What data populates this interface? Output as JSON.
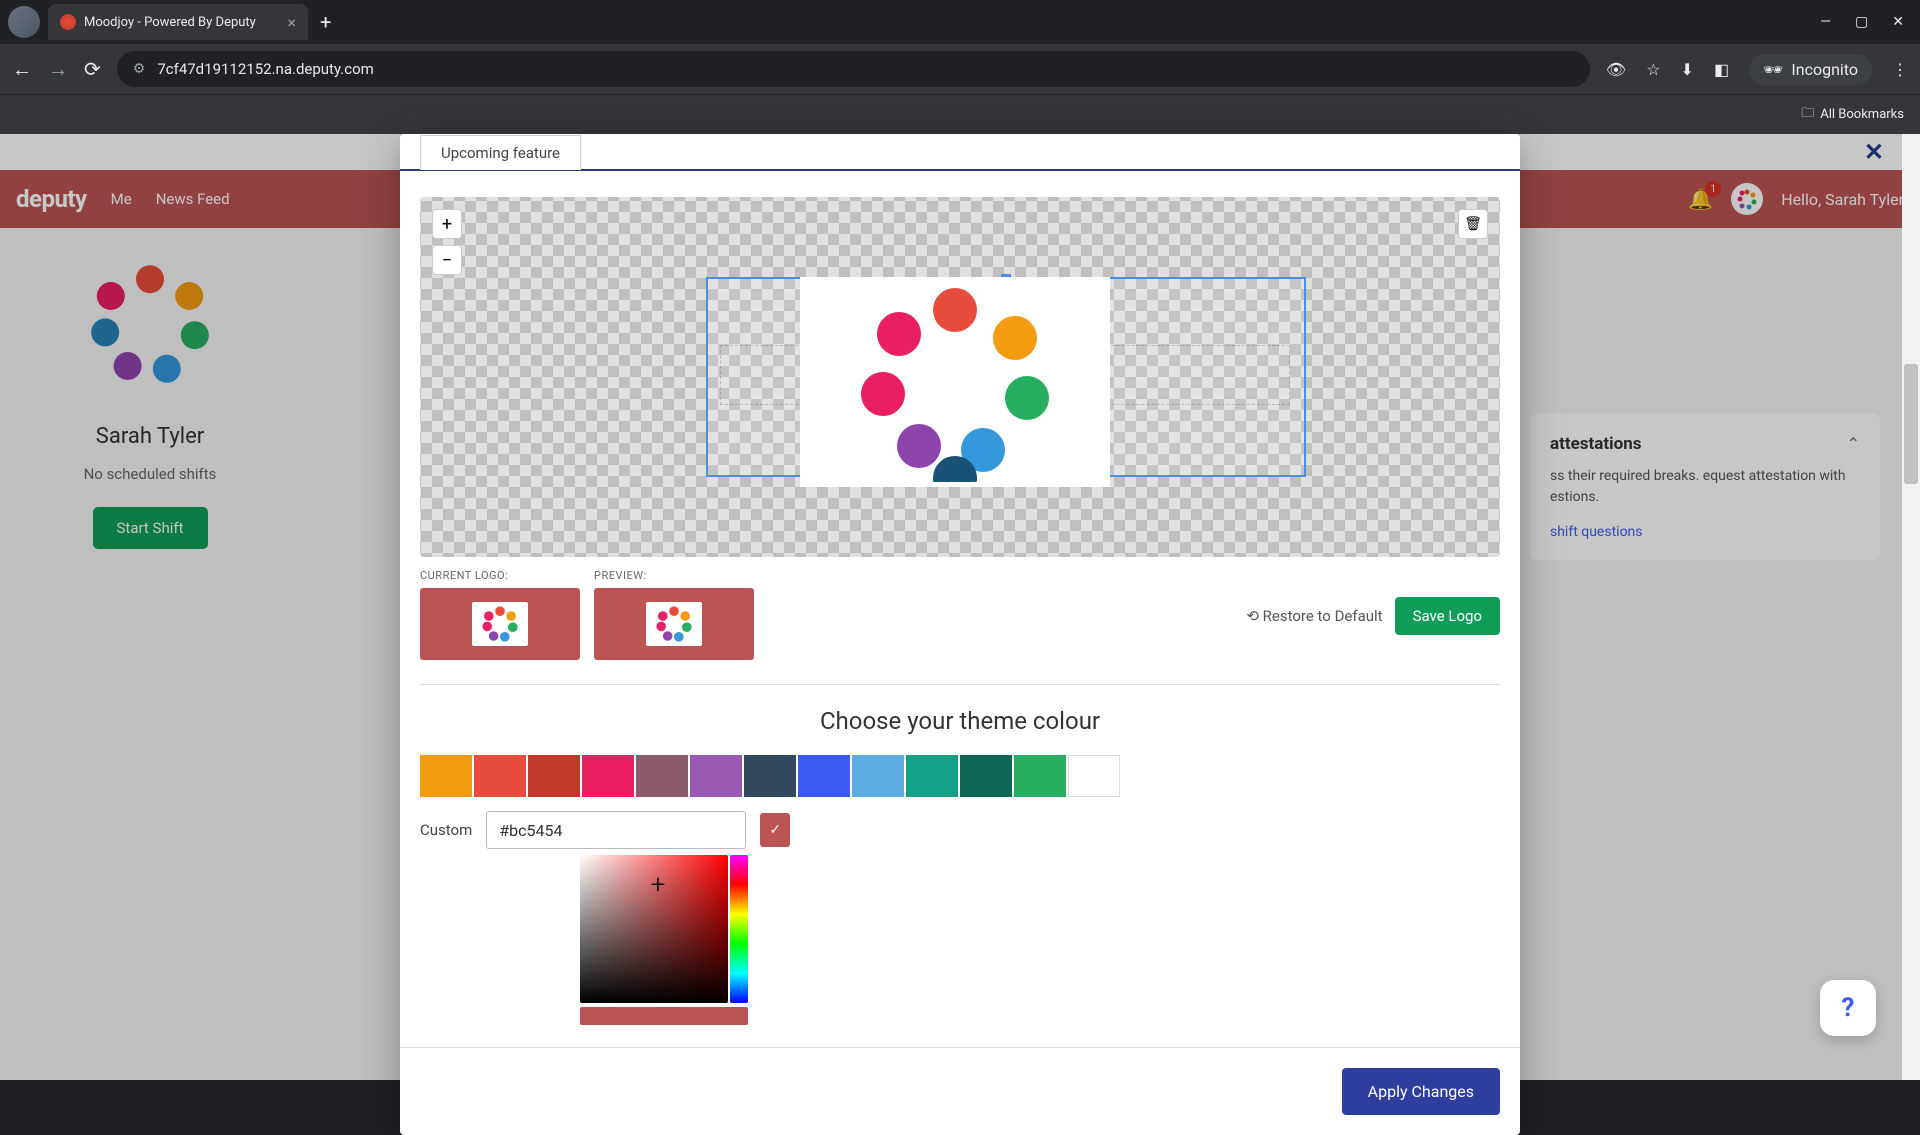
{
  "browser": {
    "tab_title": "Moodjoy - Powered By Deputy",
    "url": "7cf47d19112152.na.deputy.com",
    "incognito_label": "Incognito",
    "all_bookmarks": "All Bookmarks"
  },
  "app": {
    "brand": "deputy",
    "nav": {
      "me": "Me",
      "news": "News Feed"
    },
    "greeting": "Hello, Sarah Tyler",
    "bell_count": "1"
  },
  "sidebar": {
    "user_name": "Sarah Tyler",
    "no_shifts": "No scheduled shifts",
    "start_shift": "Start Shift"
  },
  "right_panel": {
    "title": "attestations",
    "body": "ss their required breaks. equest attestation with estions.",
    "link": "shift questions"
  },
  "modal": {
    "tab_label": "Upcoming feature",
    "current_logo_label": "CURRENT LOGO:",
    "preview_label": "PREVIEW:",
    "restore": "Restore to Default",
    "save_logo": "Save Logo",
    "theme_title": "Choose your theme colour",
    "custom_label": "Custom",
    "hex_value": "#bc5454",
    "apply": "Apply Changes",
    "zoom_in": "+",
    "zoom_out": "−"
  },
  "swatches": [
    "#f39c12",
    "#e74c3c",
    "#c0392b",
    "#e91e63",
    "#8b5a6b",
    "#9b59b6",
    "#34495e",
    "#3d5af1",
    "#5dade2",
    "#16a085",
    "#0e6655",
    "#27ae60"
  ],
  "help_fab": "?"
}
